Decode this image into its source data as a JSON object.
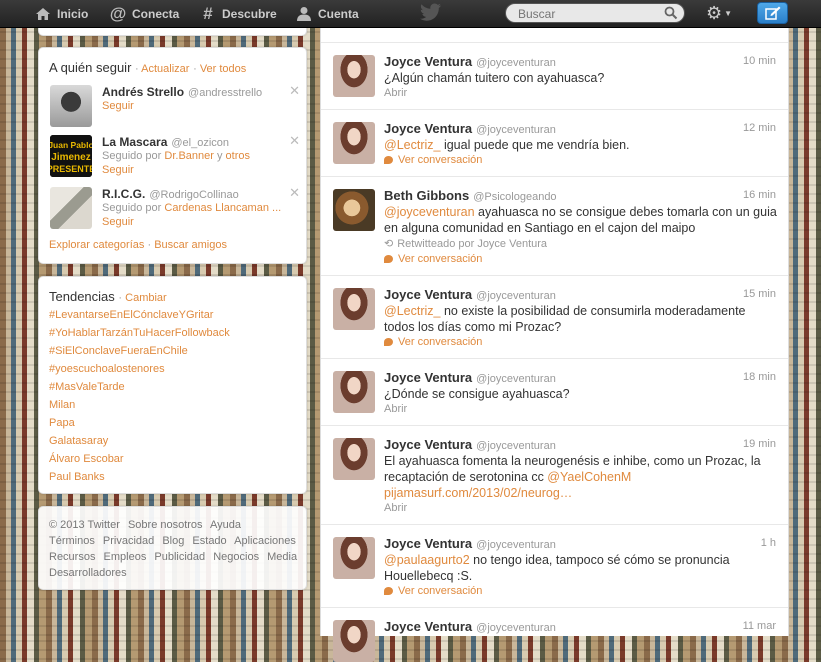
{
  "nav": {
    "home": "Inicio",
    "connect": "Conecta",
    "discover": "Descubre",
    "account": "Cuenta",
    "search_placeholder": "Buscar"
  },
  "colors": {
    "accent": "#e08a3e",
    "topbar": "#2a2a2a",
    "compose": "#2a7fc9"
  },
  "who_to_follow": {
    "title": "A quién seguir",
    "refresh": "Actualizar",
    "view_all": "Ver todos",
    "suggestions": [
      {
        "name": "Andrés Strello",
        "handle": "@andresstrello",
        "sub": "",
        "follow": "Seguir"
      },
      {
        "name": "La Mascara",
        "handle": "@el_ozicon",
        "sub_prefix": "Seguido por",
        "sub_link1": "Dr.Banner",
        "sub_mid": "y",
        "sub_link2": "otros",
        "follow": "Seguir",
        "avatar_text": "Juan Pablo Jimenez PRESENTE"
      },
      {
        "name": "R.I.C.G.",
        "handle": "@RodrigoCollinao",
        "sub_prefix": "Seguido por",
        "sub_link1": "Cardenas Llancaman ...",
        "follow": "Seguir"
      }
    ],
    "explore": "Explorar categorías",
    "find": "Buscar amigos"
  },
  "trends": {
    "title": "Tendencias",
    "change": "Cambiar",
    "items": [
      "#LevantarseEnElCónclaveYGritar",
      "#YoHablarTarzánTuHacerFollowback",
      "#SiElConclaveFueraEnChile",
      "#yoescuchoalostenores",
      "#MasValeTarde",
      "Milan",
      "Papa",
      "Galatasaray",
      "Álvaro Escobar",
      "Paul Banks"
    ]
  },
  "footer": {
    "line1": [
      "© 2013 Twitter",
      "Sobre nosotros",
      "Ayuda"
    ],
    "line2": [
      "Términos",
      "Privacidad",
      "Blog",
      "Estado",
      "Aplicaciones"
    ],
    "line3": [
      "Recursos",
      "Empleos",
      "Publicidad",
      "Negocios",
      "Media"
    ],
    "line4": [
      "Desarrolladores"
    ]
  },
  "tweets": [
    {
      "name": "Joyce Ventura",
      "handle": "@joyceventuran",
      "time": "10 min",
      "text": "¿Algún chamán tuitero con ayahuasca?",
      "action": "Abrir"
    },
    {
      "name": "Joyce Ventura",
      "handle": "@joyceventuran",
      "time": "12 min",
      "mention": "@Lectriz_",
      "text": " igual puede que me vendría bien.",
      "action": "Ver conversación"
    },
    {
      "name": "Beth Gibbons",
      "handle": "@Psicologeando",
      "time": "16 min",
      "mention": "@joyceventuran",
      "text": " ayahuasca no se consigue debes tomarla con un guia en alguna comunidad en Santiago en el cajon del maipo",
      "retweet": "Retwitteado por Joyce Ventura",
      "action": "Ver conversación"
    },
    {
      "name": "Joyce Ventura",
      "handle": "@joyceventuran",
      "time": "15 min",
      "mention": "@Lectriz_",
      "text": " no existe la posibilidad de consumirla moderadamente todos los días como mi Prozac?",
      "action": "Ver conversación"
    },
    {
      "name": "Joyce Ventura",
      "handle": "@joyceventuran",
      "time": "18 min",
      "text": "¿Dónde se consigue ayahuasca?",
      "action": "Abrir"
    },
    {
      "name": "Joyce Ventura",
      "handle": "@joyceventuran",
      "time": "19 min",
      "text": "El ayahuasca fomenta la neurogenésis e inhibe, como un Prozac, la recaptación de serotonina cc ",
      "mention": "@YaelCohenM",
      "link": "pijamasurf.com/2013/02/neurog…",
      "action": "Abrir"
    },
    {
      "name": "Joyce Ventura",
      "handle": "@joyceventuran",
      "time": "1 h",
      "mention": "@paulaagurto2",
      "text": " no tengo idea, tampoco sé cómo se pronuncia Houellebecq :S.",
      "action": "Ver conversación"
    },
    {
      "name": "Joyce Ventura",
      "handle": "@joyceventuran",
      "time": "11 mar"
    }
  ]
}
